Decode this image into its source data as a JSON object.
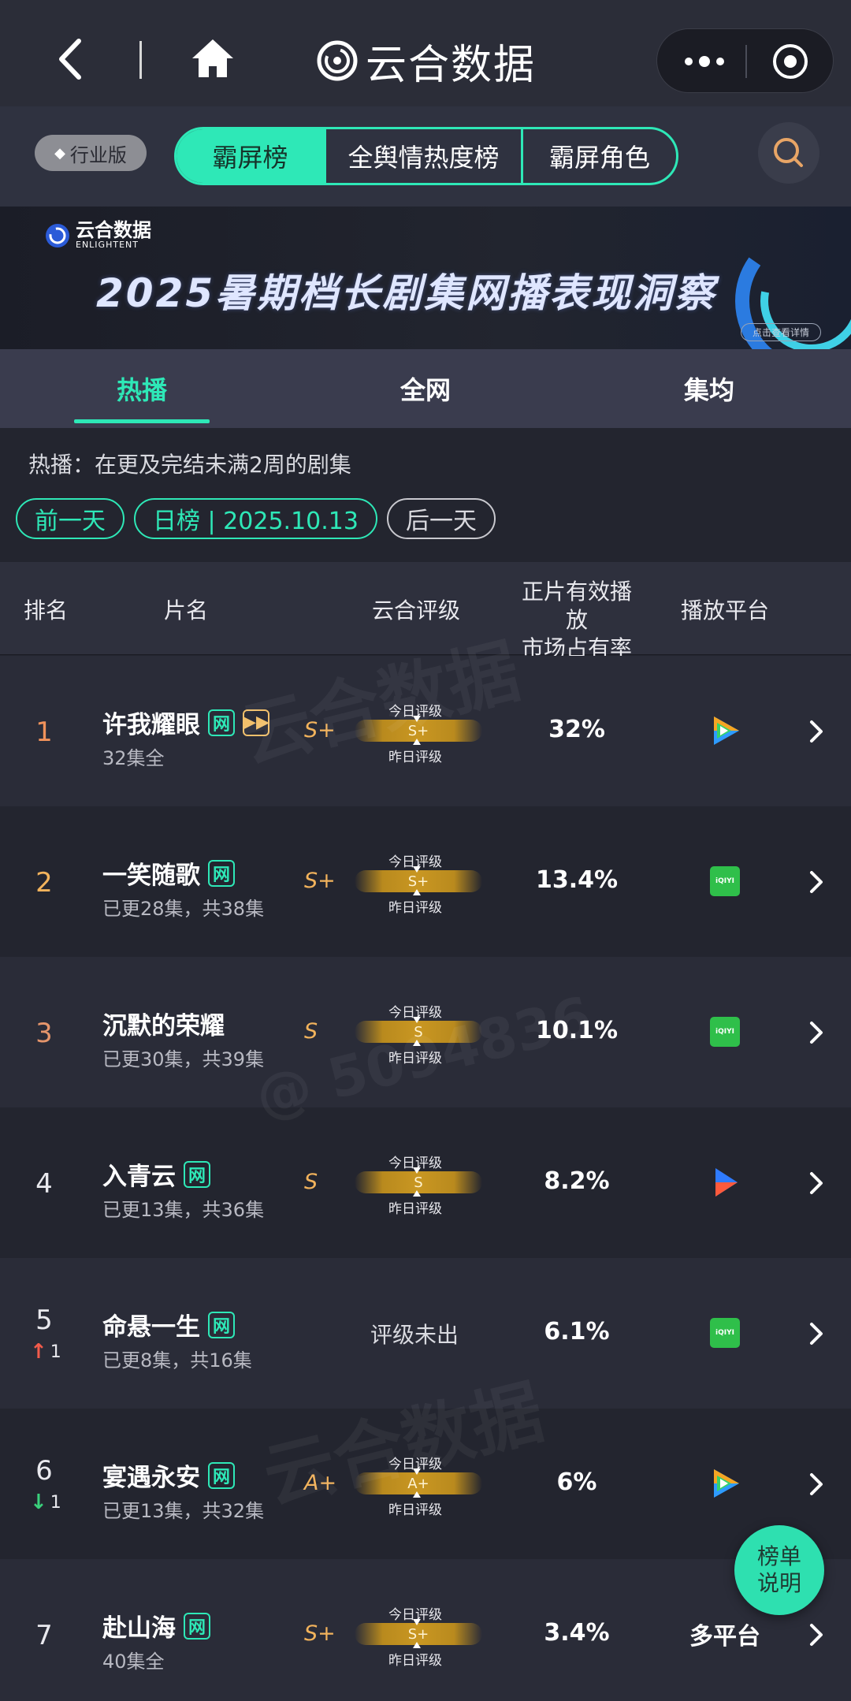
{
  "app": {
    "brand_name": "云合数据"
  },
  "header": {
    "edition_label": "行业版",
    "seg_tabs": [
      "霸屏榜",
      "全舆情热度榜",
      "霸屏角色"
    ],
    "active_seg": 0
  },
  "banner": {
    "logo_cn": "云合数据",
    "logo_en": "ENLIGHTENT",
    "title": "2025暑期档长剧集网播表现洞察",
    "cta": "点击查看详情"
  },
  "main_tabs": [
    "热播",
    "全网",
    "集均"
  ],
  "description": "热播：在更及完结未满2周的剧集",
  "date_nav": {
    "prev": "前一天",
    "current": "日榜 | 2025.10.13",
    "next": "后一天"
  },
  "table_header": {
    "rank": "排名",
    "title": "片名",
    "rating": "云合评级",
    "share_line1": "正片有效播放",
    "share_line2": "市场占有率",
    "platform": "播放平台"
  },
  "rating_labels": {
    "today": "今日评级",
    "yesterday": "昨日评级"
  },
  "rows": [
    {
      "rank": "1",
      "title": "许我耀眼",
      "episodes": "32集全",
      "tags": [
        "网",
        "▶▶"
      ],
      "grade_yesterday": "S+",
      "grade_today": "S+",
      "share": "32%",
      "platform": "tencent-video",
      "change": null
    },
    {
      "rank": "2",
      "title": "一笑随歌",
      "episodes": "已更28集，共38集",
      "tags": [
        "网"
      ],
      "grade_yesterday": "S+",
      "grade_today": "S+",
      "share": "13.4%",
      "platform": "iqiyi",
      "change": null
    },
    {
      "rank": "3",
      "title": "沉默的荣耀",
      "episodes": "已更30集，共39集",
      "tags": [],
      "grade_yesterday": "S",
      "grade_today": "S",
      "share": "10.1%",
      "platform": "iqiyi",
      "change": null
    },
    {
      "rank": "4",
      "title": "入青云",
      "episodes": "已更13集，共36集",
      "tags": [
        "网"
      ],
      "grade_yesterday": "S",
      "grade_today": "S",
      "share": "8.2%",
      "platform": "youku",
      "change": null
    },
    {
      "rank": "5",
      "title": "命悬一生",
      "episodes": "已更8集，共16集",
      "tags": [
        "网"
      ],
      "grade_yesterday": "",
      "grade_today": "",
      "no_rating": "评级未出",
      "share": "6.1%",
      "platform": "iqiyi",
      "change": {
        "dir": "up",
        "value": "1"
      }
    },
    {
      "rank": "6",
      "title": "宴遇永安",
      "episodes": "已更13集，共32集",
      "tags": [
        "网"
      ],
      "grade_yesterday": "A+",
      "grade_today": "A+",
      "share": "6%",
      "platform": "tencent-video",
      "change": {
        "dir": "down",
        "value": "1"
      }
    },
    {
      "rank": "7",
      "title": "赴山海",
      "episodes": "40集全",
      "tags": [
        "网"
      ],
      "grade_yesterday": "S+",
      "grade_today": "S+",
      "share": "3.4%",
      "platform": "多平台",
      "change": null
    }
  ],
  "platform_icons": {
    "iqiyi_text": "iQIYI"
  },
  "fab": {
    "line1": "榜单",
    "line2": "说明"
  },
  "colors": {
    "accent": "#2ee8b7",
    "grade": "#f2b35c",
    "background": "#23252f"
  }
}
